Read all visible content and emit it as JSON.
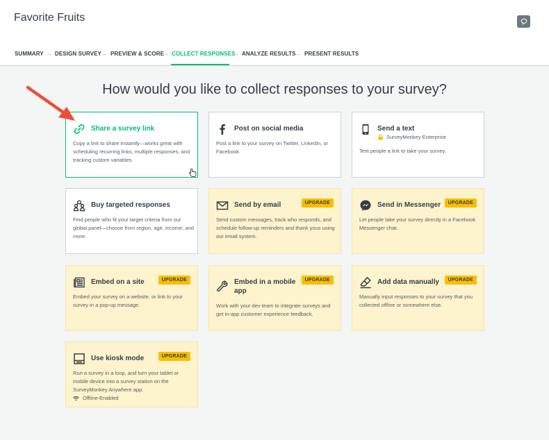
{
  "header": {
    "title": "Favorite Fruits",
    "chat_icon": "speech-bubble-icon"
  },
  "nav": {
    "steps": [
      {
        "label": "SUMMARY"
      },
      {
        "label": "DESIGN SURVEY"
      },
      {
        "label": "PREVIEW & SCORE"
      },
      {
        "label": "COLLECT RESPONSES",
        "active": true
      },
      {
        "label": "ANALYZE RESULTS"
      },
      {
        "label": "PRESENT RESULTS"
      }
    ],
    "separator": "→"
  },
  "main": {
    "heading": "How would you like to collect responses to your survey?",
    "cards": [
      {
        "id": "share-link",
        "icon": "link-icon",
        "title": "Share a survey link",
        "description": "Copy a link to share instantly—works great with scheduling recurring links, multiple responses, and tracking custom variables",
        "selected": true
      },
      {
        "id": "social-media",
        "icon": "facebook-icon",
        "title": "Post on social media",
        "description": "Post a link to your survey on Twitter, LinkedIn, or Facebook."
      },
      {
        "id": "send-text",
        "icon": "mobile-phone-icon",
        "title": "Send a text",
        "subtitle": "SurveyMonkey Enterprise",
        "subtitle_icon": "lock-icon",
        "description": "Text people a link to take your survey."
      },
      {
        "id": "targeted-responses",
        "icon": "people-group-icon",
        "title": "Buy targeted responses",
        "description": "Find people who fit your target criteria from our global panel—choose from region, age, income, and more."
      },
      {
        "id": "email",
        "icon": "envelope-icon",
        "title": "Send by email",
        "badge": "UPGRADE",
        "description": "Send custom messages, track who responds, and schedule follow-up reminders and thank yous using our email system."
      },
      {
        "id": "messenger",
        "icon": "messenger-icon",
        "title": "Send in Messenger",
        "badge": "UPGRADE",
        "description": "Let people take your survey directly in a Facebook Messenger chat."
      },
      {
        "id": "embed-site",
        "icon": "newspaper-icon",
        "title": "Embed on a site",
        "badge": "UPGRADE",
        "description": "Embed your survey on a website, or link to your survey in a pop-up message."
      },
      {
        "id": "embed-mobile",
        "icon": "wrench-icon",
        "title": "Embed in a mobile app",
        "badge": "UPGRADE",
        "description": "Work with your dev team to integrate surveys and get in-app customer experience feedback."
      },
      {
        "id": "manual-data",
        "icon": "pencil-eraser-icon",
        "title": "Add data manually",
        "badge": "UPGRADE",
        "description": "Manually input responses to your survey that you collected offline or somewhere else."
      },
      {
        "id": "kiosk",
        "icon": "kiosk-icon",
        "title": "Use kiosk mode",
        "badge": "UPGRADE",
        "description": "Run a survey in a loop, and turn your tablet or mobile device into a survey station on the SurveyMonkey Anywhere app.",
        "feature": "Offline-Enabled",
        "feature_icon": "wifi-icon"
      }
    ]
  },
  "colors": {
    "accent": "#00bf6f",
    "annotation_arrow": "#e8503a",
    "upgrade_badge": "#f9be00",
    "upgrade_card": "#fdf3cd"
  }
}
